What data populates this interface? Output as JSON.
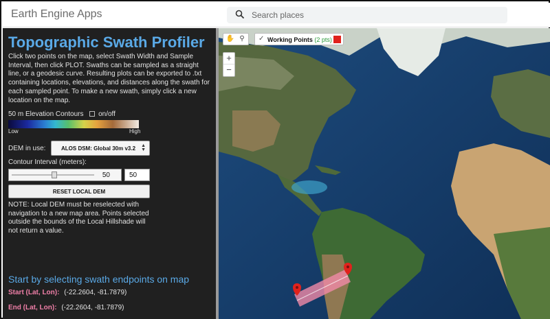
{
  "app": {
    "title": "Earth Engine Apps"
  },
  "search": {
    "placeholder": "Search places"
  },
  "panel": {
    "title": "Topographic Swath Profiler",
    "description": "Click two points on the map, select Swath Width and Sample Interval, then click PLOT. Swaths can be sampled as a straight line, or a geodesic curve. Resulting plots can be exported to .txt containing locations, elevations, and distances along the swath for each sampled point. To make a new swath, simply click a new location on the map.",
    "contours_label": "50 m Elevation Contours",
    "contours_toggle": "on/off",
    "legend_low": "Low",
    "legend_high": "High",
    "dem_label": "DEM in use:",
    "dem_value": "ALOS DSM: Global 30m v3.2",
    "contour_interval_label": "Contour Interval (meters):",
    "slider_value": "50",
    "contour_interval_value": "50",
    "reset_label": "RESET LOCAL DEM",
    "note": "NOTE: Local DEM must be reselected with navigation to a new map area. Points selected outside the bounds of the Local Hillshade will not return a value.",
    "start_heading": "Start by selecting swath endpoints on map",
    "start_label": "Start (Lat, Lon):",
    "start_value": "(-22.2604, -81.7879)",
    "end_label": "End (Lat, Lon):",
    "end_value": "(-22.2604, -81.7879)"
  },
  "map": {
    "layer_name": "Working Points",
    "layer_count": "(2 pts)",
    "layer_color": "#e0221c",
    "zoom_in": "+",
    "zoom_out": "−",
    "tools": [
      "hand-icon",
      "pin-icon"
    ]
  },
  "colors": {
    "accent": "#5aa9e6",
    "panel_bg": "#202020",
    "endpoint_label": "#f07fa8",
    "swath": "#f08aa8"
  }
}
